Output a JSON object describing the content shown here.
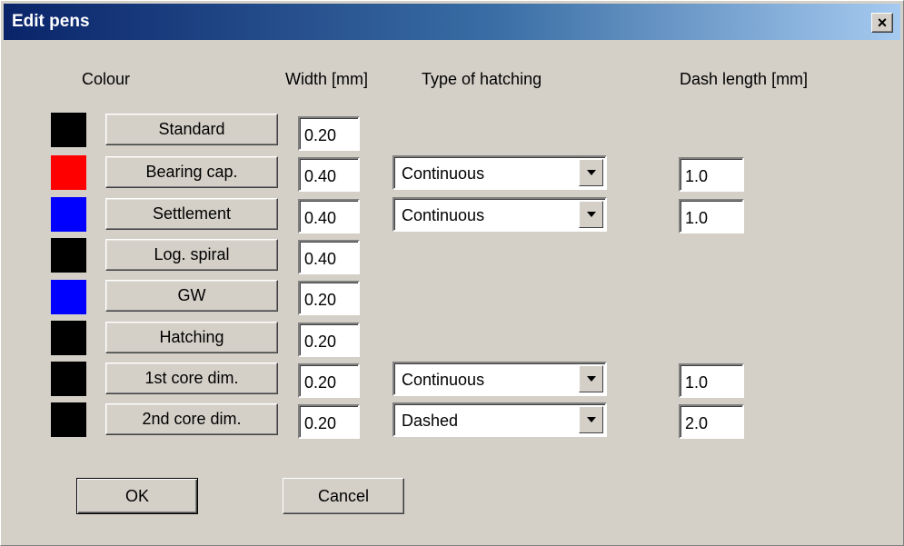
{
  "window": {
    "title": "Edit pens",
    "close_glyph": "×"
  },
  "headers": {
    "colour": "Colour",
    "width": "Width [mm]",
    "hatching": "Type of hatching",
    "dash": "Dash length [mm]"
  },
  "pens": [
    {
      "name": "Standard",
      "color": "#000000",
      "width": "0.20",
      "hatching": null,
      "dash": null
    },
    {
      "name": "Bearing cap.",
      "color": "#ff0000",
      "width": "0.40",
      "hatching": "Continuous",
      "dash": "1.0"
    },
    {
      "name": "Settlement",
      "color": "#0000ff",
      "width": "0.40",
      "hatching": "Continuous",
      "dash": "1.0"
    },
    {
      "name": "Log. spiral",
      "color": "#000000",
      "width": "0.40",
      "hatching": null,
      "dash": null
    },
    {
      "name": "GW",
      "color": "#0000ff",
      "width": "0.20",
      "hatching": null,
      "dash": null
    },
    {
      "name": "Hatching",
      "color": "#000000",
      "width": "0.20",
      "hatching": null,
      "dash": null
    },
    {
      "name": "1st core dim.",
      "color": "#000000",
      "width": "0.20",
      "hatching": "Continuous",
      "dash": "1.0"
    },
    {
      "name": "2nd core dim.",
      "color": "#000000",
      "width": "0.20",
      "hatching": "Dashed",
      "dash": "2.0"
    }
  ],
  "buttons": {
    "ok": "OK",
    "cancel": "Cancel"
  }
}
